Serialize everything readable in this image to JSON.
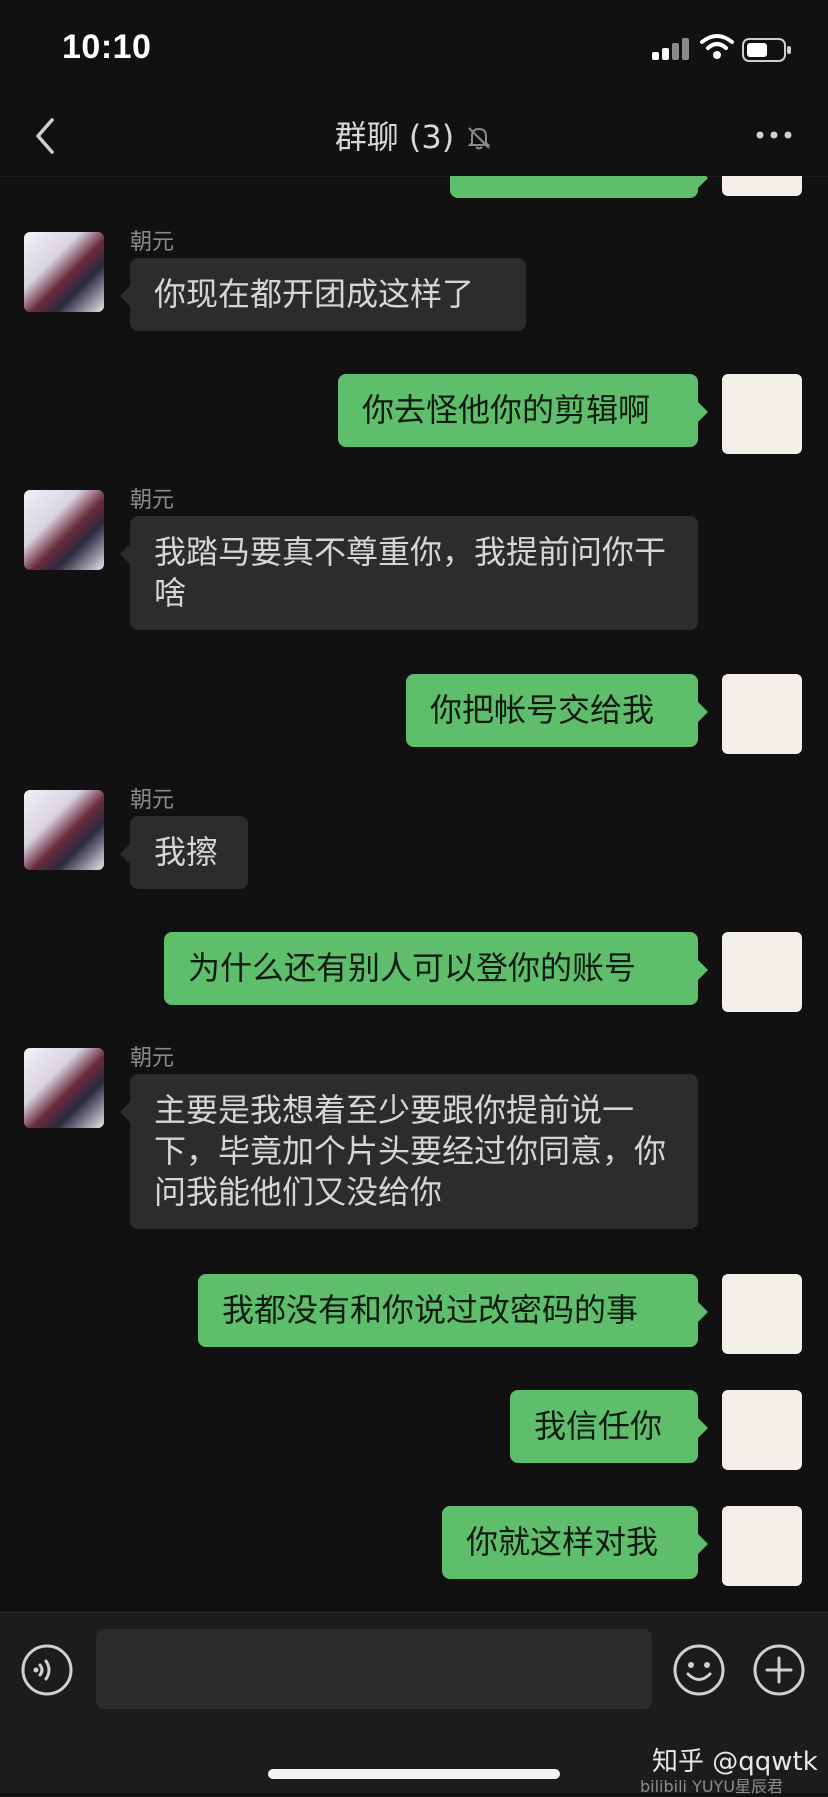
{
  "status": {
    "time": "10:10"
  },
  "header": {
    "title": "群聊 (3)"
  },
  "messages": [
    {
      "text": "你现在都开团成这样了",
      "name": "朝元"
    },
    {
      "text": "你去怪他你的剪辑啊"
    },
    {
      "text": "我踏马要真不尊重你，我提前问你干啥",
      "name": "朝元"
    },
    {
      "text": "你把帐号交给我"
    },
    {
      "text": "我擦",
      "name": "朝元"
    },
    {
      "text": "为什么还有别人可以登你的账号"
    },
    {
      "text": "主要是我想着至少要跟你提前说一下，毕竟加个片头要经过你同意，你问我能他们又没给你",
      "name": "朝元"
    },
    {
      "text": "我都没有和你说过改密码的事"
    },
    {
      "text": "我信任你"
    },
    {
      "text": "你就这样对我"
    }
  ],
  "watermark": {
    "zhihu": "知乎 @qqwtk",
    "bili": "bilibili YUYU星辰君"
  },
  "colors": {
    "outgoing": "#5fbe6b",
    "incoming": "#2c2c2c",
    "background": "#111111"
  },
  "icons": [
    "back-icon",
    "mute-bell-icon",
    "more-icon",
    "voice-icon",
    "emoji-icon",
    "plus-icon",
    "signal-icon",
    "wifi-icon",
    "battery-icon"
  ]
}
